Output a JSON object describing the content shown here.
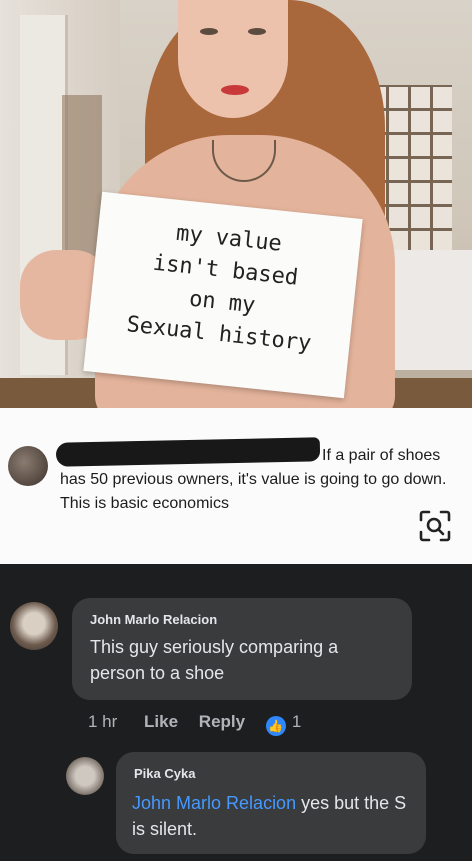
{
  "photo": {
    "sign_lines": [
      "my value",
      "isn't based",
      "on my",
      "Sexual history"
    ]
  },
  "original_comment": {
    "text_first_line": "If a pair of",
    "text_rest": "shoes has 50 previous owners, it's value is going to go down. This is basic economics"
  },
  "reply": {
    "author": "John Marlo Relacion",
    "text": "This guy seriously comparing a person to a shoe",
    "time": "1 hr",
    "like_label": "Like",
    "reply_label": "Reply",
    "reaction_count": "1"
  },
  "nested_reply": {
    "author": "Pika Cyka",
    "mention": "John Marlo Relacion",
    "text": " yes but the S is silent."
  },
  "colors": {
    "dark_bg": "#1d1e20",
    "bubble": "#3a3b3c",
    "mention": "#4599ff",
    "like_blue": "#2d88ff"
  }
}
